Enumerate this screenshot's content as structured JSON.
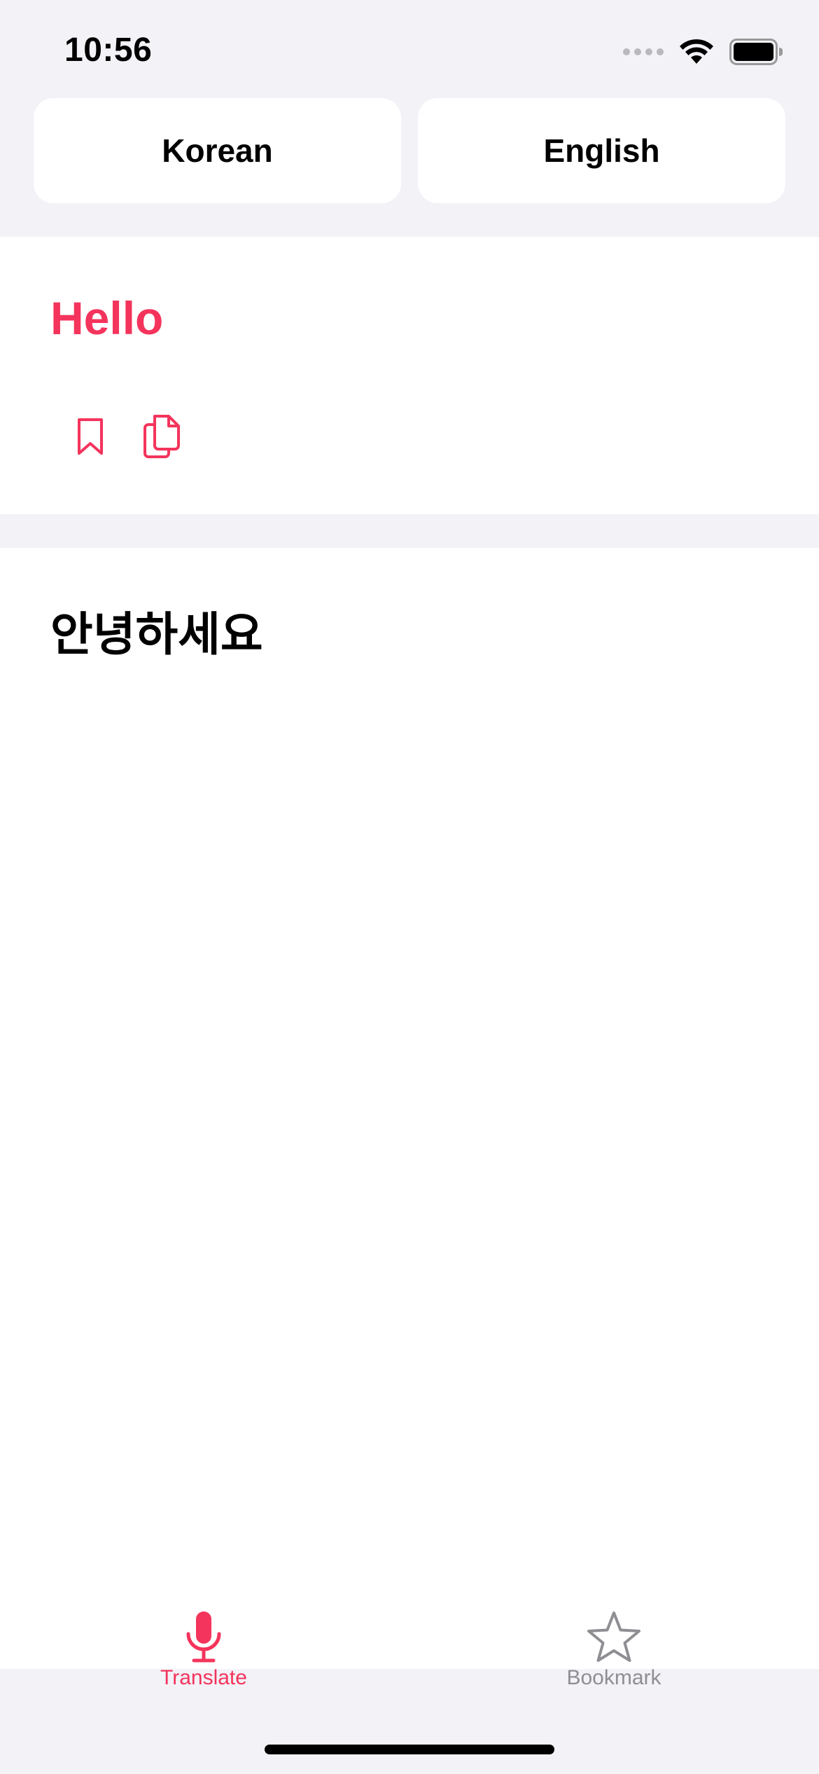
{
  "status_bar": {
    "time": "10:56",
    "icons": [
      "cellular-signal-icon",
      "wifi-icon",
      "battery-icon"
    ]
  },
  "language_selector": {
    "source_language": "Korean",
    "target_language": "English"
  },
  "source": {
    "text": "Hello",
    "actions": [
      "bookmark-icon",
      "copy-icon"
    ]
  },
  "translation": {
    "text": "안녕하세요"
  },
  "tab_bar": {
    "tabs": [
      {
        "label": "Translate",
        "icon": "microphone-icon",
        "active": true
      },
      {
        "label": "Bookmark",
        "icon": "star-icon",
        "active": false
      }
    ]
  },
  "colors": {
    "accent": "#f4345c",
    "background": "#f2f2f7",
    "card": "#ffffff",
    "inactive": "#8e8e93"
  }
}
